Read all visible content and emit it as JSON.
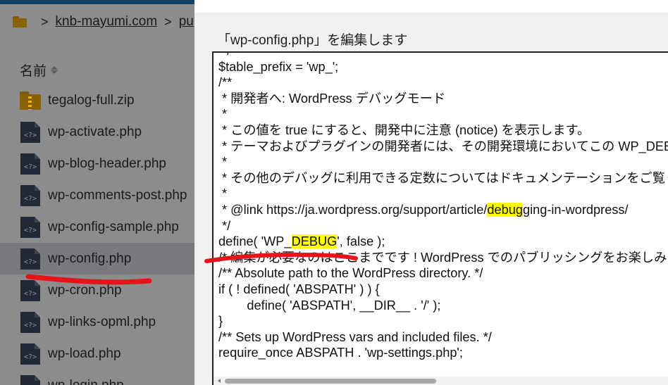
{
  "colors": {
    "accent_bar": "#1e73be",
    "folder": "#f4b400",
    "php_icon": "#3d4a63",
    "selected_row": "#d9dde3",
    "highlight": "#ffff00",
    "annotation_red": "#e5141a"
  },
  "file_manager": {
    "breadcrumb": {
      "folder_icon": "folder-icon",
      "items": [
        "knb-mayumi.com",
        "pu"
      ]
    },
    "column_header": "名前",
    "files": [
      {
        "name": "tegalog-full.zip",
        "icon": "zip-icon",
        "selected": false
      },
      {
        "name": "wp-activate.php",
        "icon": "php-file-icon",
        "selected": false
      },
      {
        "name": "wp-blog-header.php",
        "icon": "php-file-icon",
        "selected": false
      },
      {
        "name": "wp-comments-post.php",
        "icon": "php-file-icon",
        "selected": false
      },
      {
        "name": "wp-config-sample.php",
        "icon": "php-file-icon",
        "selected": false
      },
      {
        "name": "wp-config.php",
        "icon": "php-file-icon",
        "selected": true
      },
      {
        "name": "wp-cron.php",
        "icon": "php-file-icon",
        "selected": false
      },
      {
        "name": "wp-links-opml.php",
        "icon": "php-file-icon",
        "selected": false
      },
      {
        "name": "wp-load.php",
        "icon": "php-file-icon",
        "selected": false
      },
      {
        "name": "wp-login.php",
        "icon": "php-file-icon",
        "selected": false
      }
    ]
  },
  "dialog": {
    "title": "「wp-config.php」を編集します",
    "code_lines": [
      " */",
      "$table_prefix = 'wp_';",
      "/**",
      " * 開発者へ: WordPress デバッグモード",
      " *",
      " * この値を true にすると、開発中に注意 (notice) を表示します。",
      " * テーマおよびプラグインの開発者には、その開発環境においてこの WP_DEBUG を使用することを強く推奨します。",
      " *",
      " * その他のデバッグに利用できる定数についてはドキュメンテーションをご覧ください。",
      " *",
      " * @link https://ja.wordpress.org/support/article/debugging-in-wordpress/",
      " */",
      "define( 'WP_DEBUG', false );",
      "/* 編集が必要なのはここまでです ! WordPress でのパブリッシングをお楽しみください。 */",
      "/** Absolute path to the WordPress directory. */",
      "if ( ! defined( 'ABSPATH' ) ) {",
      "\tdefine( 'ABSPATH', __DIR__ . '/' );",
      "}",
      "/** Sets up WordPress vars and included files. */",
      "require_once ABSPATH . 'wp-settings.php';"
    ],
    "highlight_term": "DEBUG",
    "highlight_term_lower": "debug"
  }
}
